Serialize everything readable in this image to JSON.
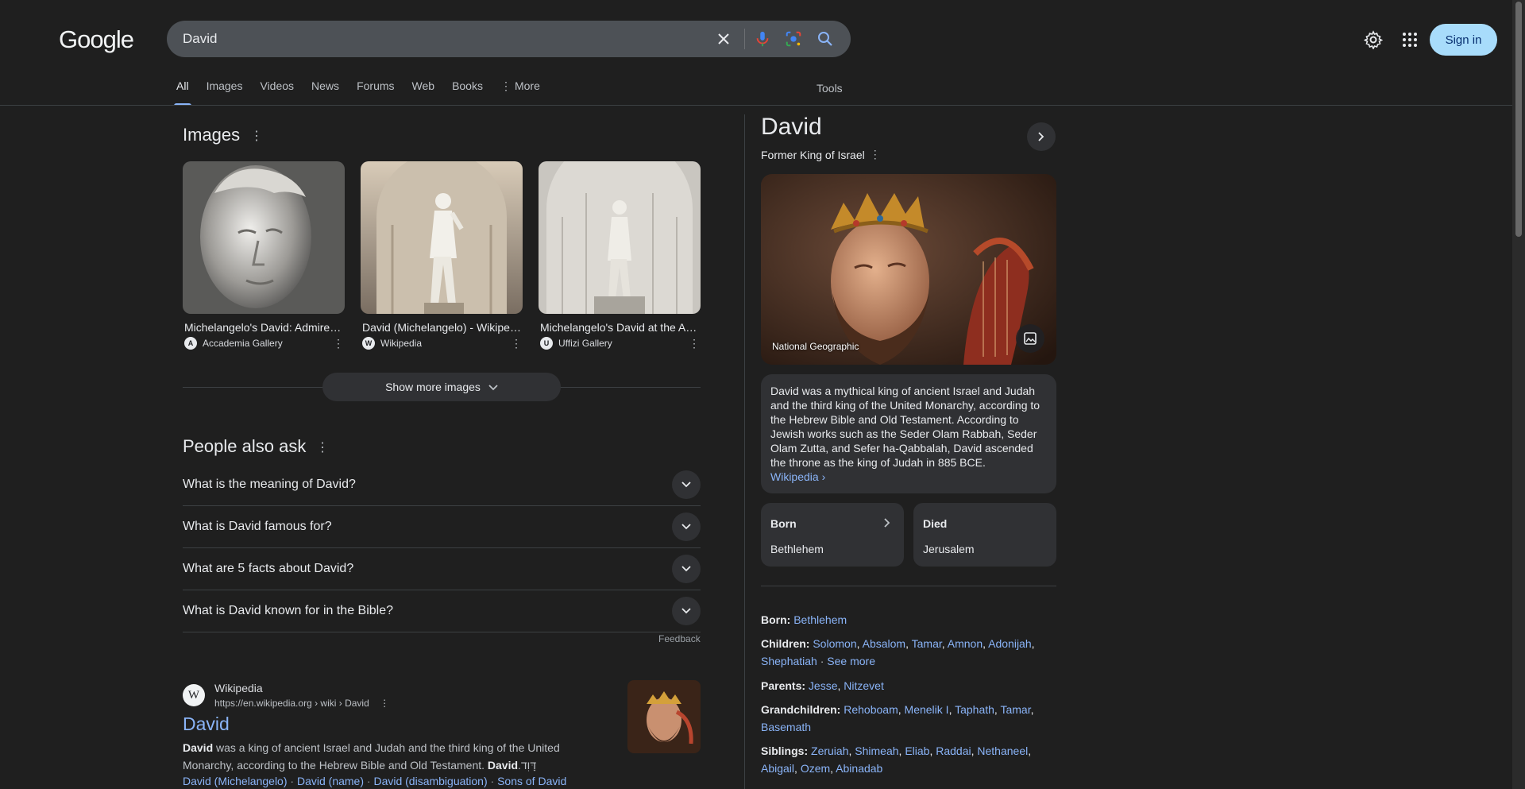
{
  "header": {
    "logo": "Google",
    "search_value": "David",
    "signin_label": "Sign in"
  },
  "tabs": [
    {
      "label": "All",
      "active": true
    },
    {
      "label": "Images"
    },
    {
      "label": "Videos"
    },
    {
      "label": "News"
    },
    {
      "label": "Forums"
    },
    {
      "label": "Web"
    },
    {
      "label": "Books"
    },
    {
      "label": "More"
    }
  ],
  "tools_label": "Tools",
  "images_section": {
    "title": "Images",
    "cards": [
      {
        "title": "Michelangelo's David: Admired...",
        "source": "Accademia Gallery",
        "favicon": "A"
      },
      {
        "title": "David (Michelangelo) - Wikipedia",
        "source": "Wikipedia",
        "favicon": "W"
      },
      {
        "title": "Michelangelo's David at the Accademia",
        "source": "Uffizi Gallery",
        "favicon": "U"
      }
    ],
    "show_more": "Show more images"
  },
  "paa": {
    "title": "People also ask",
    "questions": [
      "What is the meaning of David?",
      "What is David famous for?",
      "What are 5 facts about David?",
      "What is David known for in the Bible?"
    ],
    "feedback": "Feedback"
  },
  "result": {
    "site": "Wikipedia",
    "url": "https://en.wikipedia.org › wiki › David",
    "title": "David",
    "snippet_bold1": "David",
    "snippet_text1": " was a king of ancient Israel and Judah and the third king of the United Monarchy, according to the Hebrew Bible and Old Testament. ",
    "snippet_bold2": "David",
    "snippet_text2": ".דָּוִד",
    "links": [
      "David (Michelangelo)",
      "David (name)",
      "David (disambiguation)",
      "Sons of David"
    ]
  },
  "knowledge_panel": {
    "title": "David",
    "subtitle": "Former King of Israel",
    "image_caption": "National Geographic",
    "description": "David was a mythical king of ancient Israel and Judah and the third king of the United Monarchy, according to the Hebrew Bible and Old Testament. According to Jewish works such as the Seder Olam Rabbah, Seder Olam Zutta, and Sefer ha-Qabbalah, David ascended the throne as the king of Judah in 885 BCE.",
    "description_source": "Wikipedia",
    "born_card": {
      "label": "Born",
      "value": "Bethlehem"
    },
    "died_card": {
      "label": "Died",
      "value": "Jerusalem"
    },
    "facts": {
      "born_label": "Born:",
      "born_value": "Bethlehem",
      "children_label": "Children:",
      "children": [
        "Solomon",
        "Absalom",
        "Tamar",
        "Amnon",
        "Adonijah",
        "Shephatiah"
      ],
      "see_more": "See more",
      "parents_label": "Parents:",
      "parents": [
        "Jesse",
        "Nitzevet"
      ],
      "grandchildren_label": "Grandchildren:",
      "grandchildren": [
        "Rehoboam",
        "Menelik I",
        "Taphath",
        "Tamar",
        "Basemath"
      ],
      "siblings_label": "Siblings:",
      "siblings": [
        "Zeruiah",
        "Shimeah",
        "Eliab",
        "Raddai",
        "Nethaneel",
        "Abigail",
        "Ozem",
        "Abinadab"
      ]
    }
  },
  "colors": {
    "background": "#1f1f1f",
    "link": "#8ab4f8",
    "signin": "#a8dcfb",
    "surface": "#303134"
  }
}
